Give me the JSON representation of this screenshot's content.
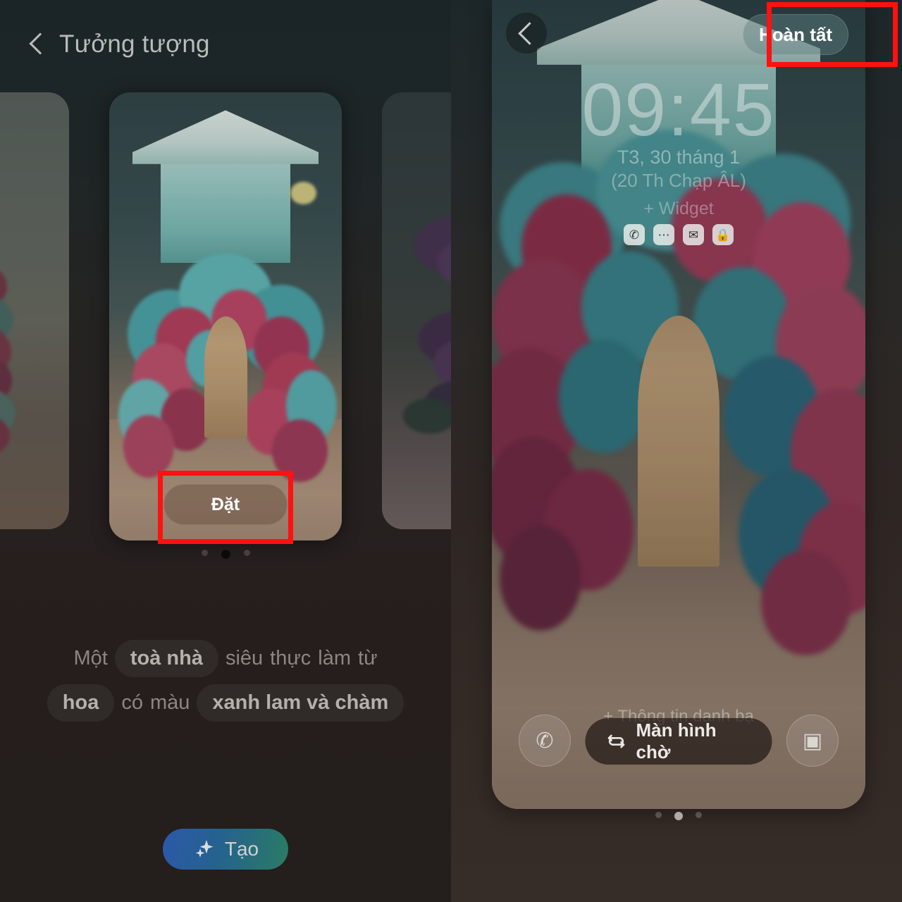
{
  "left_panel": {
    "header": {
      "back_icon": "chevron-left-icon",
      "title": "Tưởng tượng"
    },
    "carousel": {
      "set_button_label": "Đặt",
      "dots": [
        "inactive",
        "active",
        "inactive"
      ],
      "active_index": 1,
      "cards": [
        {
          "alt": "pink and teal hydrangea flowers wallpaper"
        },
        {
          "alt": "surreal house covered in blue and pink flower arch with wooden door"
        },
        {
          "alt": "purple bougainvillea tree beside house wallpaper"
        }
      ]
    },
    "prompt": {
      "row1": [
        {
          "text": "Một",
          "chip": false
        },
        {
          "text": "toà nhà",
          "chip": true
        },
        {
          "text": "siêu",
          "chip": false
        },
        {
          "text": "thực",
          "chip": false
        },
        {
          "text": "làm",
          "chip": false
        },
        {
          "text": "từ",
          "chip": false
        }
      ],
      "row2": [
        {
          "text": "hoa",
          "chip": true
        },
        {
          "text": "có",
          "chip": false
        },
        {
          "text": "màu",
          "chip": false
        },
        {
          "text": "xanh lam và chàm",
          "chip": true
        }
      ]
    },
    "create_button": {
      "label": "Tạo",
      "icon": "sparkle-icon",
      "gradient_start": "#2c58a8",
      "gradient_end": "#2a7c63"
    }
  },
  "right_panel": {
    "back_icon": "chevron-left-icon",
    "done_button_label": "Hoàn tất",
    "lock_screen": {
      "time": "09:45",
      "date": "T3, 30 tháng 1",
      "lunar_date": "(20 Th Chạp ÂL)",
      "add_widget_label": "+ Widget",
      "notifications": [
        {
          "name": "phone-icon",
          "glyph": "✆"
        },
        {
          "name": "messages-icon",
          "glyph": "⋯"
        },
        {
          "name": "mail-icon",
          "glyph": "✉"
        },
        {
          "name": "lock-app-icon",
          "glyph": "🔒"
        }
      ],
      "contact_info_label": "+ Thông tin danh bạ",
      "shortcut_left": {
        "name": "phone-shortcut-icon",
        "glyph": "✆"
      },
      "shortcut_right": {
        "name": "camera-shortcut-icon",
        "glyph": "▣"
      },
      "standby_button": {
        "label": "Màn hình chờ",
        "icon": "refresh-icon"
      },
      "dots": [
        "inactive",
        "active",
        "inactive"
      ],
      "active_index": 1
    }
  },
  "annotations": {
    "highlight_color": "#ff1111",
    "boxes": [
      {
        "target": "set-button",
        "label": "Đặt"
      },
      {
        "target": "done-button",
        "label": "Hoàn tất"
      }
    ]
  }
}
